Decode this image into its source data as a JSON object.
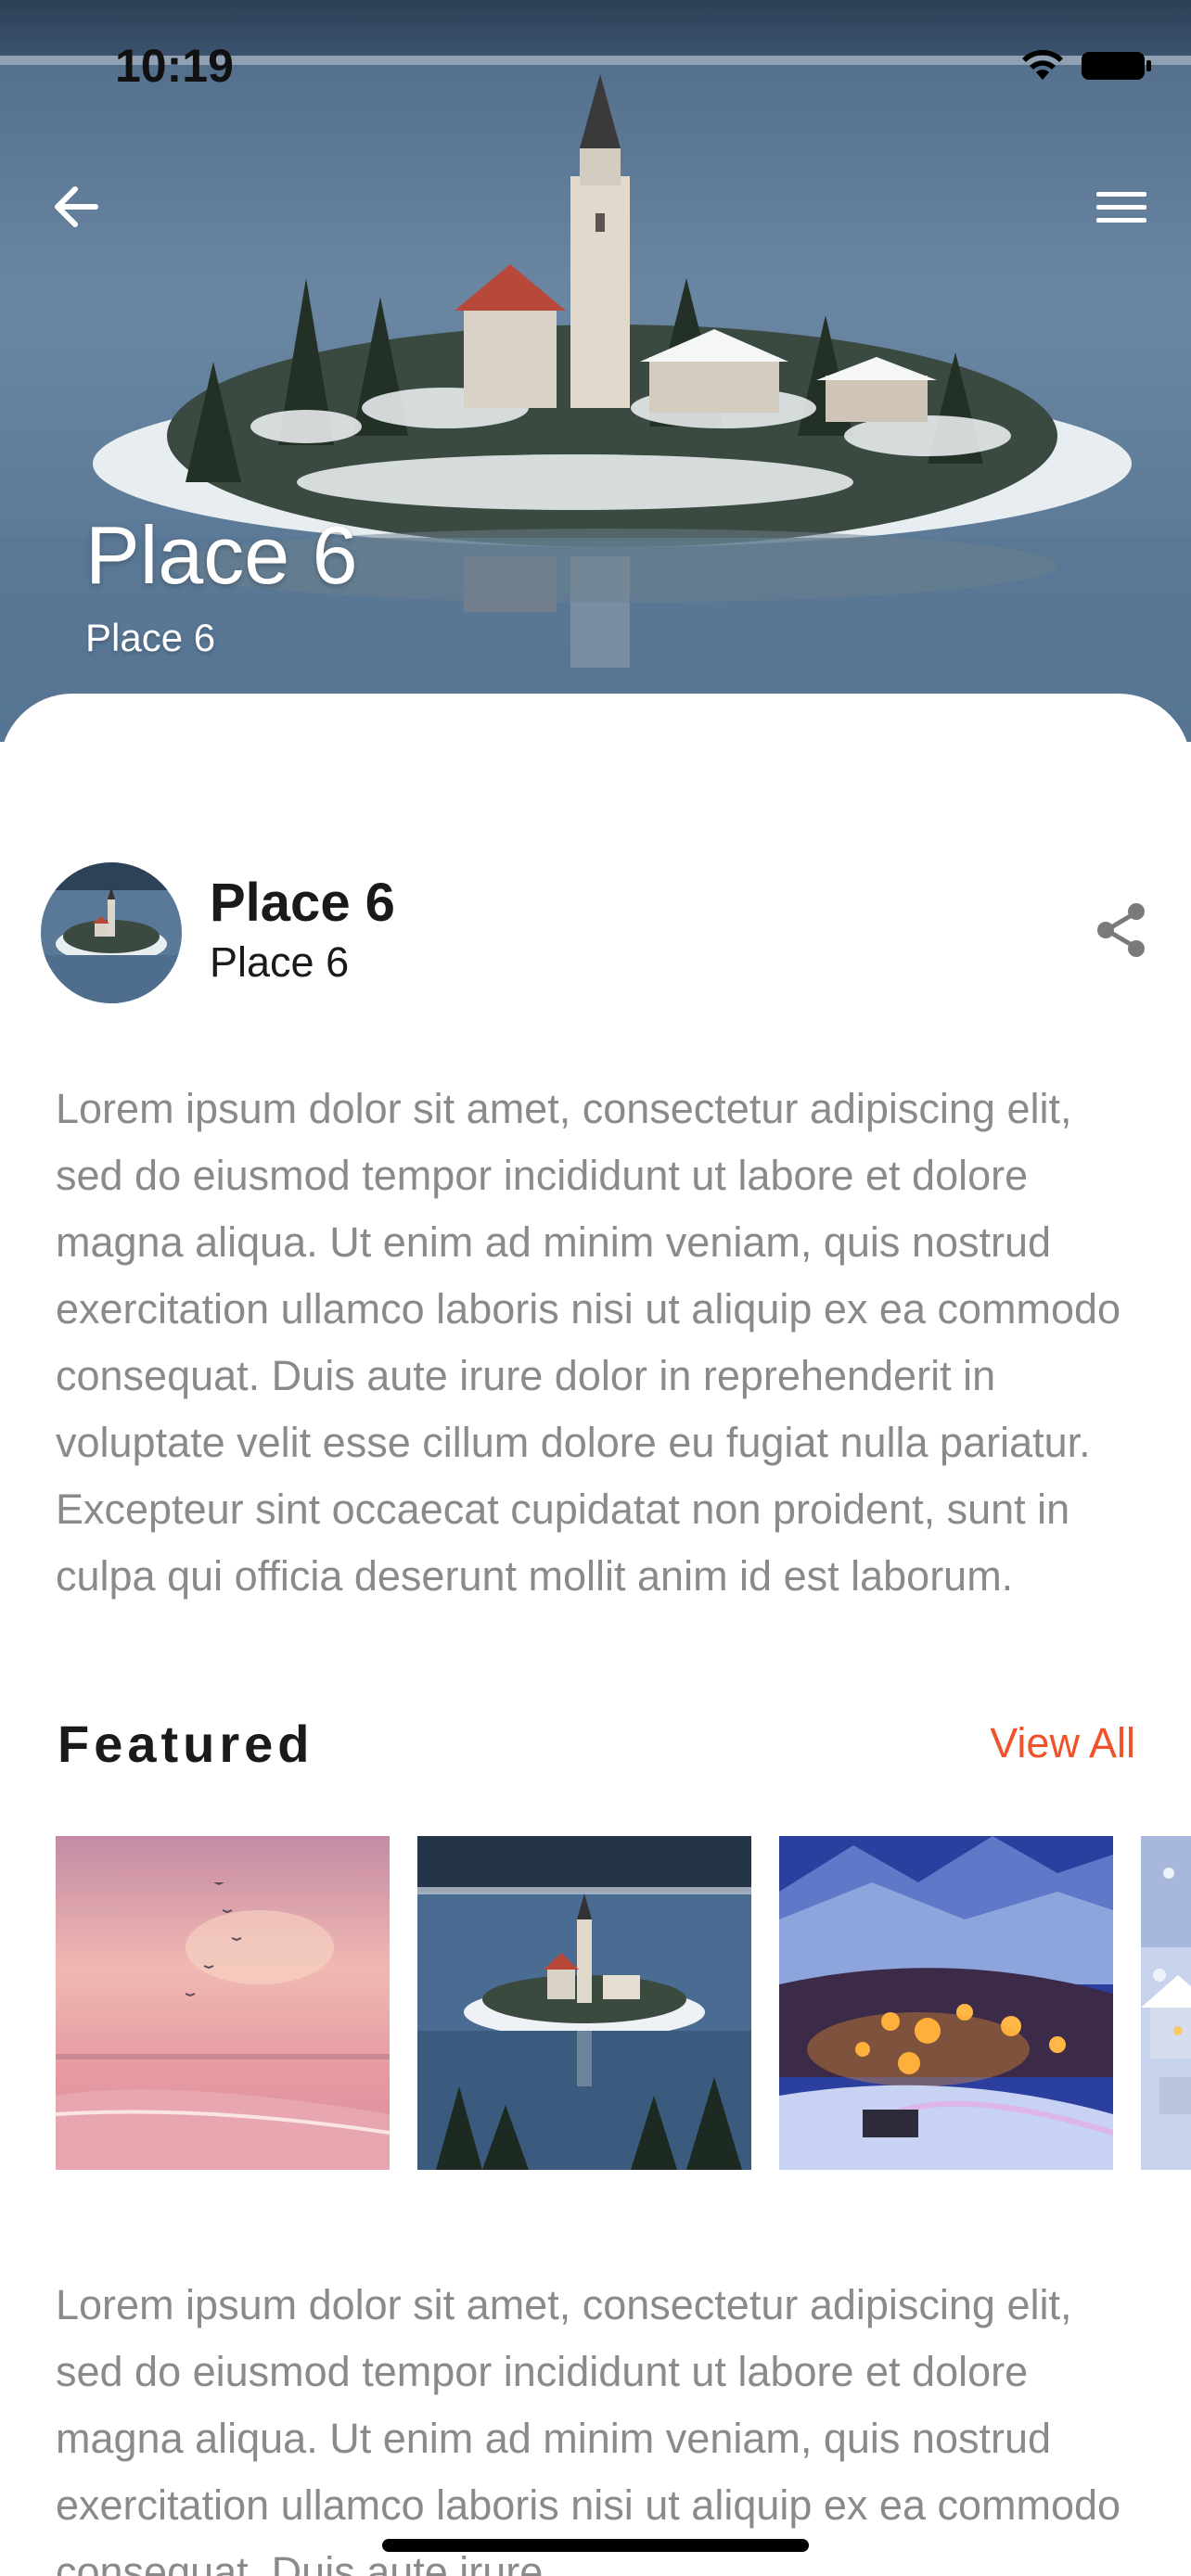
{
  "status_bar": {
    "time": "10:19"
  },
  "navigation": {
    "back_icon": "arrow-left-icon",
    "menu_icon": "hamburger-menu-icon"
  },
  "hero": {
    "title": "Place 6",
    "subtitle": "Place 6"
  },
  "profile": {
    "name": "Place 6",
    "subtitle": "Place 6",
    "share_icon": "share-icon"
  },
  "description": "Lorem ipsum dolor sit amet, consectetur adipiscing elit, sed do eiusmod tempor incididunt ut labore et dolore magna aliqua. Ut enim ad minim veniam, quis nostrud exercitation ullamco laboris nisi ut aliquip ex ea commodo consequat. Duis aute irure dolor in reprehenderit in voluptate velit esse cillum dolore eu fugiat nulla pariatur. Excepteur sint occaecat cupidatat non proident, sunt in culpa qui officia deserunt mollit anim id est laborum.",
  "featured": {
    "title": "Featured",
    "view_all_label": "View All",
    "items": [
      {
        "image": "pink-sunset-beach"
      },
      {
        "image": "snowy-lake-island-church"
      },
      {
        "image": "snowy-mountain-village-night"
      },
      {
        "image": "snowy-village"
      }
    ]
  },
  "description_2": "Lorem ipsum dolor sit amet, consectetur adipiscing elit, sed do eiusmod tempor incididunt ut labore et dolore magna aliqua. Ut enim ad minim veniam, quis nostrud exercitation ullamco laboris nisi ut aliquip ex ea commodo consequat. Duis aute irure",
  "colors": {
    "accent": "#f0522a",
    "body_text": "#8a8a8a",
    "heading": "#1a1a1a"
  }
}
